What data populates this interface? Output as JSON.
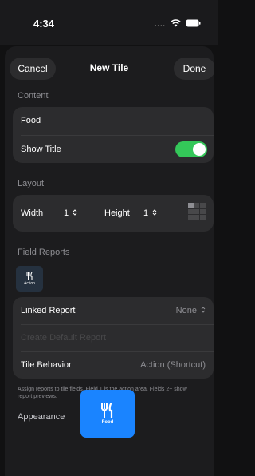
{
  "status": {
    "time": "4:34",
    "signal": "....",
    "wifi_icon": "wifi-icon",
    "battery_icon": "battery-icon"
  },
  "nav": {
    "cancel_label": "Cancel",
    "title": "New Tile",
    "done_label": "Done"
  },
  "content": {
    "section_title": "Content",
    "name_value": "Food",
    "show_title_label": "Show Title",
    "show_title_on": true
  },
  "layout": {
    "section_title": "Layout",
    "width_label": "Width",
    "width_value": "1",
    "height_label": "Height",
    "height_value": "1",
    "stepper_icon": "chevron-up-down-icon"
  },
  "field_reports": {
    "section_title": "Field Reports",
    "chip_label": "Action",
    "chip_icon": "fork-knife-icon",
    "linked_report_label": "Linked Report",
    "linked_report_value": "None",
    "create_default_label": "Create Default Report",
    "tile_behavior_label": "Tile Behavior",
    "tile_behavior_value": "Action (Shortcut)",
    "footnote": "Assign reports to tile fields. Field 1 is the action area. Fields 2+ show report previews."
  },
  "appearance": {
    "section_title": "Appearance",
    "tile_label": "Food",
    "tile_icon": "fork-knife-icon",
    "tile_color": "#1a84ff"
  },
  "colors": {
    "accent": "#34c759",
    "card": "#2c2c2e",
    "background": "#1c1c1e"
  }
}
